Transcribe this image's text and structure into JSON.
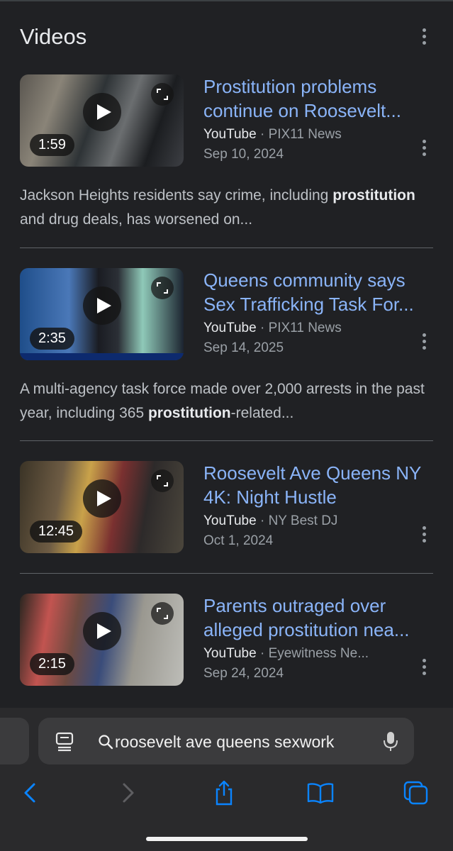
{
  "section": {
    "title": "Videos"
  },
  "videos": [
    {
      "title": "Prostitution problems continue on Roosevelt...",
      "platform": "YouTube",
      "channel": "PIX11 News",
      "date": "Sep 10, 2024",
      "duration": "1:59",
      "snippet_before": "Jackson Heights residents say crime, including ",
      "snippet_bold": "prostitution",
      "snippet_after": " and drug deals, has worsened on..."
    },
    {
      "title": "Queens community says Sex Trafficking Task For...",
      "platform": "YouTube",
      "channel": "PIX11 News",
      "date": "Sep 14, 2025",
      "duration": "2:35",
      "snippet_before": "A multi-agency task force made over 2,000 arrests in the past year, including 365 ",
      "snippet_bold": "prostitution",
      "snippet_after": "-related..."
    },
    {
      "title": "Roosevelt Ave Queens NY 4K: Night Hustle",
      "platform": "YouTube",
      "channel": "NY Best DJ",
      "date": "Oct 1, 2024",
      "duration": "12:45"
    },
    {
      "title": "Parents outraged over alleged prostitution nea...",
      "platform": "YouTube",
      "channel": "Eyewitness Ne...",
      "date": "Sep 24, 2024",
      "duration": "2:15"
    }
  ],
  "search": {
    "query": "roosevelt ave queens sexwork"
  },
  "colors": {
    "background": "#202124",
    "link": "#8ab4f8",
    "ios_blue": "#0a84ff"
  }
}
